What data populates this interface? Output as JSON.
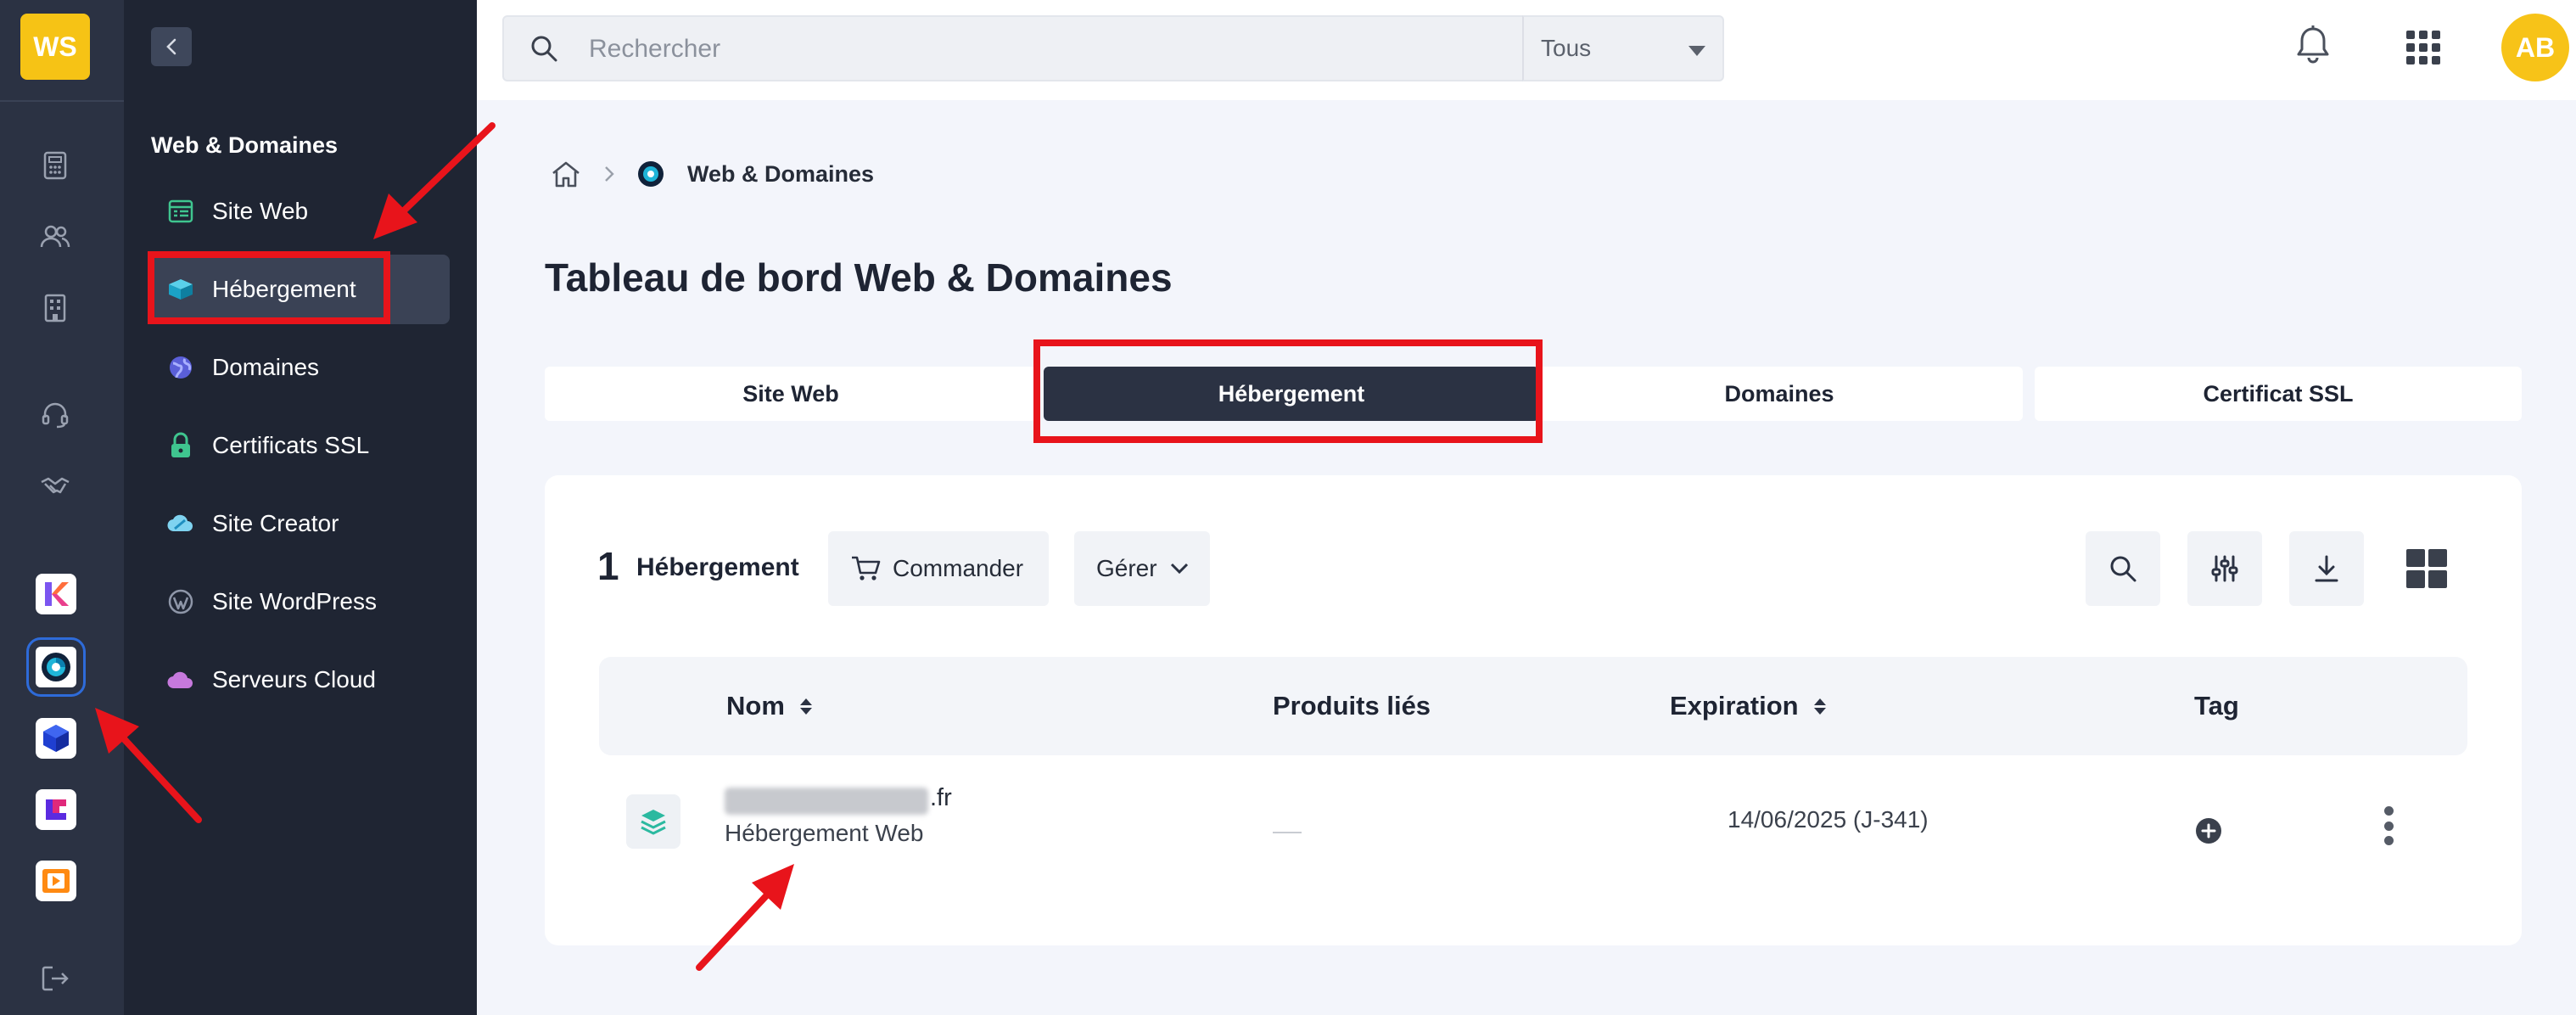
{
  "rail": {
    "logo": "WS",
    "nav_icons": [
      "calculator-icon",
      "users-icon",
      "building-icon",
      "headset-icon",
      "handshake-icon"
    ],
    "apps": [
      "kchat-app-icon",
      "web-domains-app-icon",
      "cube-app-icon",
      "kdrive-app-icon",
      "media-app-icon"
    ],
    "logout_icon": "logout-icon"
  },
  "menu": {
    "section_title": "Web & Domaines",
    "items": [
      {
        "label": "Site Web",
        "icon": "website-icon"
      },
      {
        "label": "Hébergement",
        "icon": "hosting-icon",
        "active": true
      },
      {
        "label": "Domaines",
        "icon": "globe-icon"
      },
      {
        "label": "Certificats SSL",
        "icon": "lock-icon"
      },
      {
        "label": "Site Creator",
        "icon": "site-creator-icon"
      },
      {
        "label": "Site WordPress",
        "icon": "wordpress-icon"
      },
      {
        "label": "Serveurs Cloud",
        "icon": "cloud-icon"
      }
    ]
  },
  "topbar": {
    "search_placeholder": "Rechercher",
    "scope": "Tous",
    "avatar": "AB"
  },
  "breadcrumb": {
    "current": "Web & Domaines"
  },
  "page_title": "Tableau de bord Web & Domaines",
  "tabs": [
    {
      "label": "Site Web"
    },
    {
      "label": "Hébergement",
      "active": true
    },
    {
      "label": "Domaines"
    },
    {
      "label": "Certificat SSL"
    }
  ],
  "list": {
    "count": "1",
    "count_label": "Hébergement",
    "order_button": "Commander",
    "manage_button": "Gérer",
    "columns": [
      "Nom",
      "Produits liés",
      "Expiration",
      "Tag"
    ],
    "rows": [
      {
        "domain_suffix": ".fr",
        "type": "Hébergement Web",
        "expiration": "14/06/2025 (J-341)"
      }
    ]
  },
  "colors": {
    "accent": "#2b3243",
    "highlight": "#e8141b",
    "logo": "#f6c315"
  }
}
